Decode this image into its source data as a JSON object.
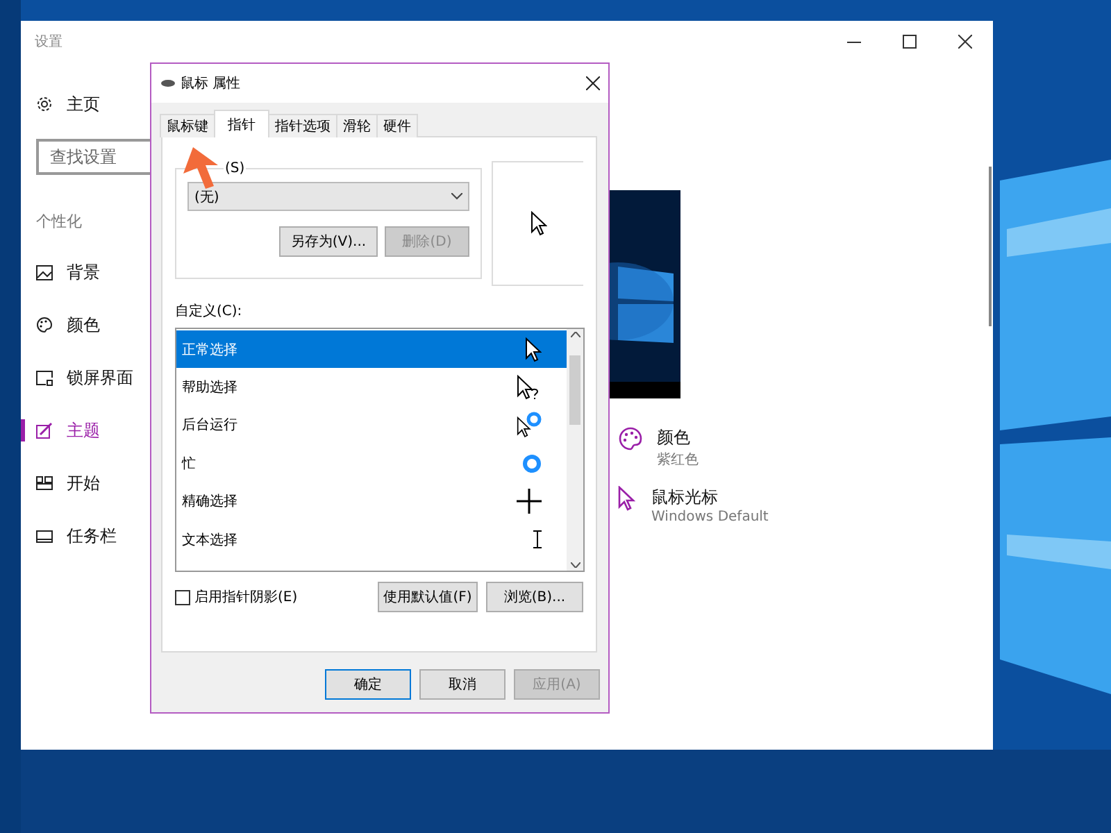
{
  "settings": {
    "title": "设置",
    "home": "主页",
    "search": {
      "placeholder": "查找设置"
    },
    "section": "个性化",
    "nav": [
      {
        "label": "背景",
        "selected": false
      },
      {
        "label": "颜色",
        "selected": false
      },
      {
        "label": "锁屏界面",
        "selected": false
      },
      {
        "label": "主题",
        "selected": true
      },
      {
        "label": "开始",
        "selected": false
      },
      {
        "label": "任务栏",
        "selected": false
      }
    ],
    "theme_items": [
      {
        "title": "颜色",
        "subtitle": "紫红色"
      },
      {
        "title": "鼠标光标",
        "subtitle": "Windows Default"
      }
    ]
  },
  "dialog": {
    "title": "鼠标 属性",
    "tabs": [
      {
        "label": "鼠标键",
        "selected": false
      },
      {
        "label": "指针",
        "selected": true
      },
      {
        "label": "指针选项",
        "selected": false
      },
      {
        "label": "滑轮",
        "selected": false
      },
      {
        "label": "硬件",
        "selected": false
      }
    ],
    "scheme": {
      "label": "(S)",
      "value": "(无)"
    },
    "scheme_buttons": [
      {
        "label": "另存为(V)...",
        "disabled": false
      },
      {
        "label": "删除(D)",
        "disabled": true
      }
    ],
    "customize_label": "自定义(C):",
    "cursors": [
      {
        "label": "正常选择",
        "kind": "arrow",
        "selected": true
      },
      {
        "label": "帮助选择",
        "kind": "help",
        "selected": false
      },
      {
        "label": "后台运行",
        "kind": "working",
        "selected": false
      },
      {
        "label": "忙",
        "kind": "busy",
        "selected": false
      },
      {
        "label": "精确选择",
        "kind": "precision",
        "selected": false
      },
      {
        "label": "文本选择",
        "kind": "text",
        "selected": false
      }
    ],
    "shadow": {
      "label": "启用指针阴影(E)",
      "checked": false
    },
    "list_buttons": [
      "使用默认值(F)",
      "浏览(B)..."
    ],
    "buttons": [
      {
        "label": "确定",
        "default": true,
        "disabled": false
      },
      {
        "label": "取消",
        "default": false,
        "disabled": false
      },
      {
        "label": "应用(A)",
        "default": false,
        "disabled": true
      }
    ]
  }
}
